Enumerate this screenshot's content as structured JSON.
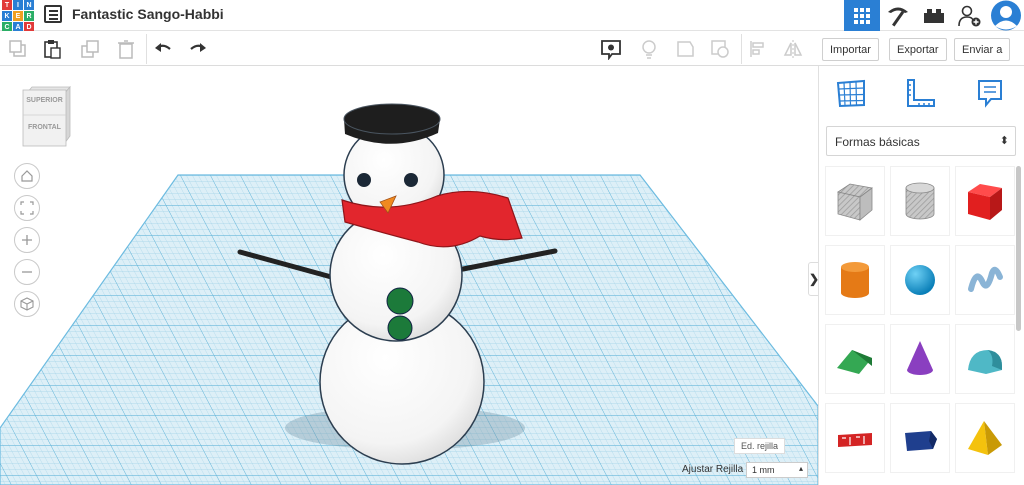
{
  "app": {
    "logo_letters": [
      "T",
      "I",
      "N",
      "K",
      "E",
      "R",
      "C",
      "A",
      "D"
    ],
    "project_title": "Fantastic Sango-Habbi"
  },
  "topbar": {
    "right_icons": [
      "grid-icon",
      "pickaxe-icon",
      "brick-icon",
      "add-user-icon",
      "avatar-icon"
    ]
  },
  "toolbar": {
    "import_label": "Importar",
    "export_label": "Exportar",
    "send_label": "Enviar a"
  },
  "viewcube": {
    "top_label": "SUPERIOR",
    "front_label": "FRONTAL"
  },
  "workplane": {
    "edit_grid_label": "Ed. rejilla",
    "snap_label": "Ajustar Rejilla",
    "snap_value": "1 mm"
  },
  "panel": {
    "category": "Formas básicas",
    "shapes": [
      "box-striped",
      "cylinder-striped",
      "box",
      "cylinder",
      "sphere",
      "scribble",
      "roof",
      "cone",
      "round-roof",
      "text",
      "polygon",
      "pyramid"
    ]
  },
  "colors": {
    "accent": "#2a7fd4",
    "grid_line": "#9bcfe6",
    "scarf": "#e2262d",
    "button": "#1c7a3a"
  }
}
